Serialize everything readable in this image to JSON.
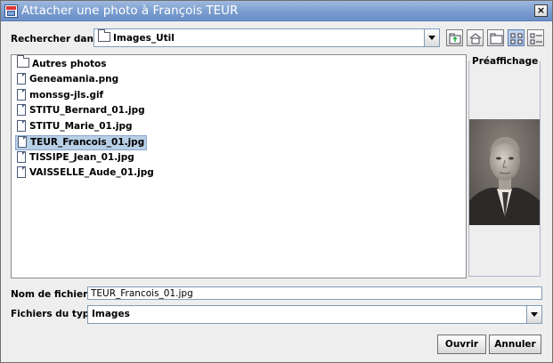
{
  "window": {
    "title": "Attacher une photo à François TEUR",
    "close_glyph": "×"
  },
  "look_in": {
    "label": "Rechercher dans :",
    "value": "Images_Util"
  },
  "toolbar": {
    "icons": [
      "up-one-level-icon",
      "home-icon",
      "new-folder-icon",
      "list-view-icon",
      "details-view-icon"
    ]
  },
  "files": [
    {
      "name": "Autres photos",
      "type": "folder"
    },
    {
      "name": "Geneamania.png",
      "type": "file"
    },
    {
      "name": "monssg-jls.gif",
      "type": "file"
    },
    {
      "name": "STITU_Bernard_01.jpg",
      "type": "file"
    },
    {
      "name": "STITU_Marie_01.jpg",
      "type": "file"
    },
    {
      "name": "TEUR_Francois_01.jpg",
      "type": "file",
      "selected": true
    },
    {
      "name": "TISSIPE_Jean_01.jpg",
      "type": "file"
    },
    {
      "name": "VAISSELLE_Aude_01.jpg",
      "type": "file"
    }
  ],
  "preview": {
    "label": "Préaffichage"
  },
  "filename": {
    "label": "Nom de fichier :",
    "value": "TEUR_Francois_01.jpg"
  },
  "filetype": {
    "label": "Fichiers du type :",
    "value": "Images"
  },
  "buttons": {
    "open": "Ouvrir",
    "cancel": "Annuler"
  }
}
